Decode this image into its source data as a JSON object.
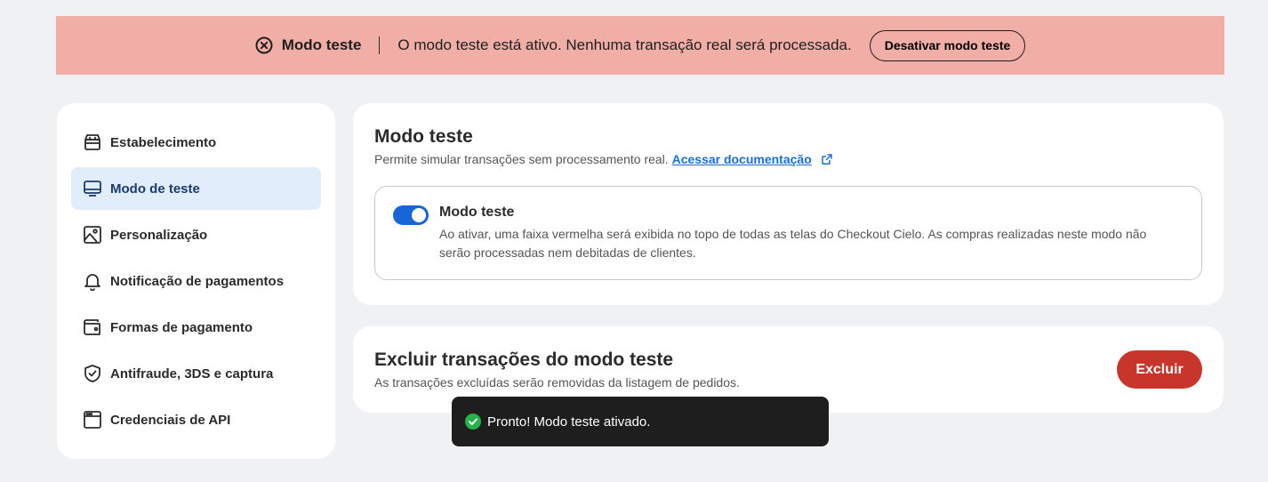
{
  "banner": {
    "title": "Modo teste",
    "message": "O modo teste está ativo. Nenhuma transação real será processada.",
    "button": "Desativar modo teste",
    "icon": "close-circle-icon",
    "background": "#f1aea7"
  },
  "sidebar": {
    "items": [
      {
        "label": "Estabelecimento",
        "icon": "store-icon"
      },
      {
        "label": "Modo de teste",
        "icon": "monitor-icon",
        "active": true
      },
      {
        "label": "Personalização",
        "icon": "image-icon"
      },
      {
        "label": "Notificação de pagamentos",
        "icon": "bell-icon"
      },
      {
        "label": "Formas de pagamento",
        "icon": "wallet-icon"
      },
      {
        "label": "Antifraude, 3DS e captura",
        "icon": "shield-check-icon"
      },
      {
        "label": "Credenciais de API",
        "icon": "browser-window-icon"
      }
    ]
  },
  "test_mode": {
    "title": "Modo teste",
    "subtitle": "Permite simular transações sem processamento real.",
    "doc_link": "Acessar documentação",
    "toggle_title": "Modo teste",
    "toggle_on": true,
    "toggle_desc": "Ao ativar, uma faixa vermelha será exibida no topo de todas as telas do Checkout Cielo. As compras realizadas neste modo não serão processadas nem debitadas de clientes."
  },
  "delete_section": {
    "title": "Excluir transações do modo teste",
    "subtitle": "As transações excluídas serão removidas da listagem de pedidos.",
    "button": "Excluir",
    "button_color": "#c8352b"
  },
  "toast": {
    "message": "Pronto! Modo teste ativado.",
    "icon": "check-circle-icon"
  }
}
